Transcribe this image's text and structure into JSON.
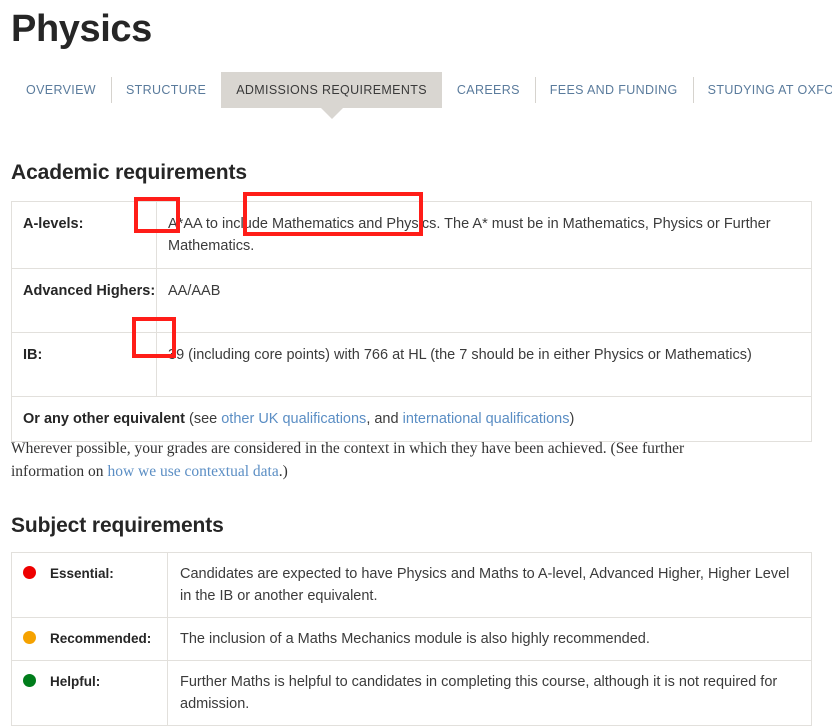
{
  "header": {
    "title": "Physics"
  },
  "tabs": [
    {
      "label": "OVERVIEW",
      "active": false
    },
    {
      "label": "STRUCTURE",
      "active": false
    },
    {
      "label": "ADMISSIONS REQUIREMENTS",
      "active": true
    },
    {
      "label": "CAREERS",
      "active": false
    },
    {
      "label": "FEES AND FUNDING",
      "active": false
    },
    {
      "label": "STUDYING AT OXFORD",
      "active": false
    }
  ],
  "academic": {
    "heading": "Academic requirements",
    "rows": [
      {
        "label": "A-levels:",
        "value": "A*AA to include Mathematics and Physics. The A* must be in Mathematics, Physics or Further Mathematics."
      },
      {
        "label": "Advanced Highers:",
        "value": "AA/AAB"
      },
      {
        "label": "IB:",
        "value": "39 (including core points) with 766 at HL (the 7 should be in either Physics or Mathematics)"
      }
    ],
    "equivalent": {
      "bold": "Or any other equivalent",
      "text_before": " (see ",
      "link1": "other UK qualifications",
      "text_middle": ", and ",
      "link2": "international qualifications",
      "text_after": ")"
    }
  },
  "context_note": {
    "text_before": "Wherever possible, your grades are considered in the context in which they have been achieved.  (See further information on ",
    "link": "how we use contextual data",
    "text_after": ".)"
  },
  "subject": {
    "heading": "Subject requirements",
    "rows": [
      {
        "label": "Essential:",
        "dot_color": "#ee0000",
        "value": "Candidates are expected to have Physics and Maths to A-level, Advanced Higher, Higher Level in the IB or another equivalent."
      },
      {
        "label": "Recommended:",
        "dot_color": "#f5a200",
        "value": "The inclusion of a Maths Mechanics module is also highly recommended."
      },
      {
        "label": "Helpful:",
        "dot_color": "#007d1b",
        "value": "Further Maths is helpful to candidates in completing this course, although it is not required for admission."
      }
    ]
  },
  "annotations": {
    "color": "#ff1d18",
    "boxes": [
      {
        "name": "a-level-grades-highlight",
        "target": "A*AA"
      },
      {
        "name": "a-level-subjects-highlight",
        "target": "Mathematics and Physics."
      },
      {
        "name": "ib-score-highlight",
        "target": "39"
      }
    ]
  }
}
